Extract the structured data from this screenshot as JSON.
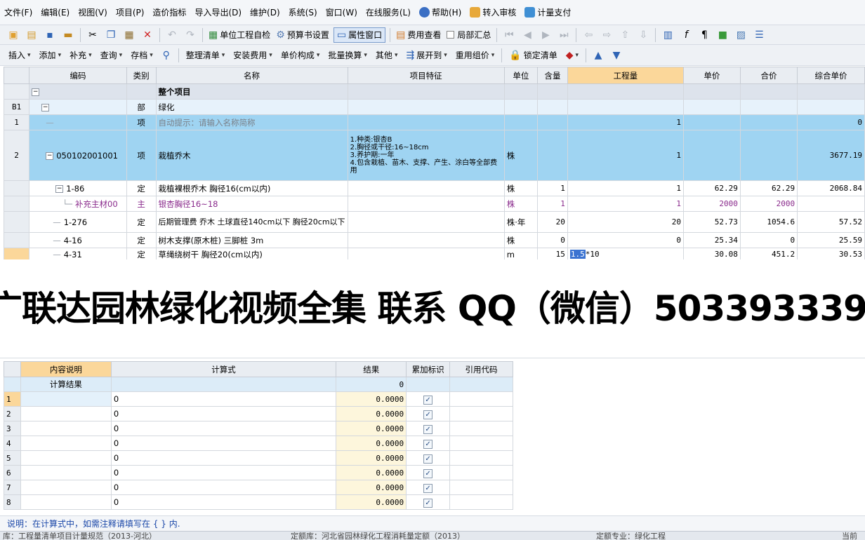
{
  "menubar": {
    "items": [
      "文件(F)",
      "编辑(E)",
      "视图(V)",
      "项目(P)",
      "造价指标",
      "导入导出(D)",
      "维护(D)",
      "系统(S)",
      "窗口(W)",
      "在线服务(L)",
      "帮助(H)",
      "转入审核",
      "计量支付"
    ]
  },
  "toolbar1": {
    "check_label": "单位工程自检",
    "budget_label": "预算书设置",
    "property_label": "属性窗口",
    "fee_label": "费用查看",
    "partial_label": "局部汇总"
  },
  "toolbar2": {
    "items": [
      "插入",
      "添加",
      "补充",
      "查询",
      "存档",
      "整理清单",
      "安装费用",
      "单价构成",
      "批量换算",
      "其他",
      "展开到",
      "重用组价",
      "锁定清单"
    ]
  },
  "grid": {
    "headers": [
      "编码",
      "类别",
      "名称",
      "项目特征",
      "单位",
      "含量",
      "工程量",
      "单价",
      "合价",
      "综合单价"
    ],
    "rows": [
      {
        "rh": "",
        "code": "",
        "type": "",
        "name": "整个项目",
        "feature": "",
        "unit": "",
        "content": "",
        "qty": "",
        "price": "",
        "total": "",
        "comp": ""
      },
      {
        "rh": "B1",
        "code": "",
        "type": "部",
        "name": "绿化",
        "feature": "",
        "unit": "",
        "content": "",
        "qty": "",
        "price": "",
        "total": "",
        "comp": ""
      },
      {
        "rh": "1",
        "code": "",
        "type": "项",
        "name": "自动提示：请输入名称简称",
        "feature": "",
        "unit": "",
        "content": "",
        "qty": "1",
        "price": "",
        "total": "",
        "comp": "0"
      },
      {
        "rh": "2",
        "code": "050102001001",
        "type": "项",
        "name": "栽植乔木",
        "feature": "1.种类:银杏B\n2.胸径或干径:16~18cm\n3.养护期:一年\n4.包含栽植、苗木、支撑、产生、涂白等全部费用",
        "unit": "株",
        "content": "",
        "qty": "1",
        "price": "",
        "total": "",
        "comp": "3677.19"
      },
      {
        "rh": "",
        "code": "1-86",
        "type": "定",
        "name": "栽植裸根乔木 胸径16(cm以内)",
        "feature": "",
        "unit": "株",
        "content": "1",
        "qty": "1",
        "price": "62.29",
        "total": "62.29",
        "comp": "2068.84"
      },
      {
        "rh": "",
        "code": "补充主材00",
        "type": "主",
        "name": "银杏胸径16~18",
        "feature": "",
        "unit": "株",
        "content": "1",
        "qty": "1",
        "price": "2000",
        "total": "2000",
        "comp": ""
      },
      {
        "rh": "",
        "code": "1-276",
        "type": "定",
        "name": "后期管理费 乔木 土球直径140cm以下 胸径20cm以下",
        "feature": "",
        "unit": "株·年",
        "content": "20",
        "qty": "20",
        "price": "52.73",
        "total": "1054.6",
        "comp": "57.52"
      },
      {
        "rh": "",
        "code": "4-16",
        "type": "定",
        "name": "树木支撑(原木桩) 三脚桩 3m",
        "feature": "",
        "unit": "株",
        "content": "0",
        "qty": "0",
        "price": "25.34",
        "total": "0",
        "comp": "25.59"
      },
      {
        "rh": "",
        "code": "4-31",
        "type": "定",
        "name": "草绳绕树干 胸径20(cm以内)",
        "feature": "",
        "unit": "m",
        "content": "15",
        "qty_sel": "1.5",
        "qty_rest": "*10",
        "price": "30.08",
        "total": "451.2",
        "comp": "30.53"
      }
    ]
  },
  "watermark": {
    "text": "广联达园林绿化视频全集 联系 QQ（微信）503393339"
  },
  "calc": {
    "headers": [
      "内容说明",
      "计算式",
      "结果",
      "累加标识",
      "引用代码"
    ],
    "total_label": "计算结果",
    "total_value": "0",
    "rows": [
      {
        "n": "1",
        "expr": "0",
        "result": "0.0000"
      },
      {
        "n": "2",
        "expr": "0",
        "result": "0.0000"
      },
      {
        "n": "3",
        "expr": "0",
        "result": "0.0000"
      },
      {
        "n": "4",
        "expr": "0",
        "result": "0.0000"
      },
      {
        "n": "5",
        "expr": "0",
        "result": "0.0000"
      },
      {
        "n": "6",
        "expr": "0",
        "result": "0.0000"
      },
      {
        "n": "7",
        "expr": "0",
        "result": "0.0000"
      },
      {
        "n": "8",
        "expr": "0",
        "result": "0.0000"
      }
    ]
  },
  "note": "说明：在计算式中，如需注释请填写在 { } 内.",
  "statusbar": [
    "库：工程量清单项目计量规范（2013-河北）",
    "定额库：河北省园林绿化工程消耗量定额（2013）",
    "定额专业：绿化工程",
    "当前"
  ]
}
